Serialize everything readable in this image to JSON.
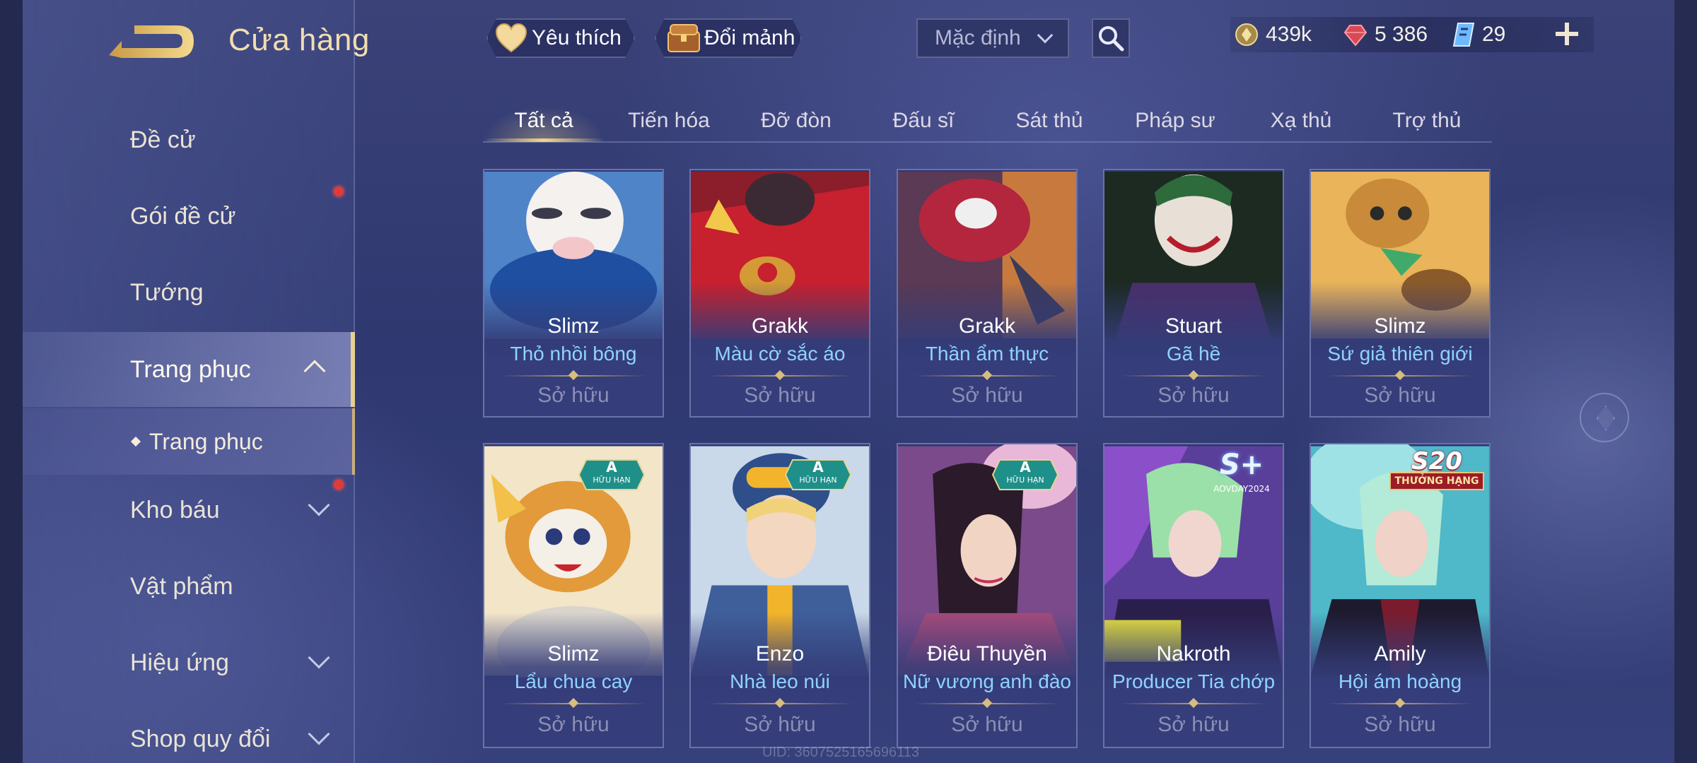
{
  "header": {
    "title": "Cửa hàng",
    "favorite_label": "Yêu thích",
    "exchange_label": "Đổi mảnh",
    "sort_selected": "Mặc định",
    "currency": {
      "gold": "439k",
      "ruby": "5 386",
      "voucher": "29"
    }
  },
  "sidebar": {
    "items": [
      {
        "label": "Đề cử"
      },
      {
        "label": "Gói đề cử"
      },
      {
        "label": "Tướng"
      },
      {
        "label": "Trang phục"
      },
      {
        "label": "Kho báu"
      },
      {
        "label": "Vật phẩm"
      },
      {
        "label": "Hiệu ứng"
      },
      {
        "label": "Shop quy đổi"
      }
    ],
    "sub_item": "Trang phục"
  },
  "tabs": [
    "Tất cả",
    "Tiến hóa",
    "Đỡ đòn",
    "Đấu sĩ",
    "Sát thủ",
    "Pháp sư",
    "Xạ thủ",
    "Trợ thủ"
  ],
  "cards": [
    {
      "hero": "Slimz",
      "skin": "Thỏ nhồi bông",
      "status": "Sở hữu"
    },
    {
      "hero": "Grakk",
      "skin": "Màu cờ sắc áo",
      "status": "Sở hữu"
    },
    {
      "hero": "Grakk",
      "skin": "Thần ẩm thực",
      "status": "Sở hữu"
    },
    {
      "hero": "Stuart",
      "skin": "Gã hề",
      "status": "Sở hữu"
    },
    {
      "hero": "Slimz",
      "skin": "Sứ giả thiên giới",
      "status": "Sở hữu"
    },
    {
      "hero": "Slimz",
      "skin": "Lẩu chua cay",
      "status": "Sở hữu",
      "badge": "A",
      "badge_sub": "HỮU HẠN"
    },
    {
      "hero": "Enzo",
      "skin": "Nhà leo núi",
      "status": "Sở hữu",
      "badge": "A",
      "badge_sub": "HỮU HẠN"
    },
    {
      "hero": "Điêu Thuyền",
      "skin": "Nữ vương anh đào",
      "status": "Sở hữu",
      "badge": "A",
      "badge_sub": "HỮU HẠN"
    },
    {
      "hero": "Nakroth",
      "skin": "Producer Tia chớp",
      "status": "Sở hữu",
      "badge": "S+",
      "badge_sub": "AOVDAY2024"
    },
    {
      "hero": "Amily",
      "skin": "Hội ám hoàng",
      "status": "Sở hữu",
      "badge": "S20",
      "badge_sub": "THƯỞNG HẠNG"
    }
  ],
  "uid_text": "UID: 3607525165696113",
  "colors": {
    "accent_gold": "#f0d489",
    "skin_name_blue": "#8fd3ff",
    "owned_gray": "#8c8fb4",
    "notification_red": "#e03a3a"
  }
}
